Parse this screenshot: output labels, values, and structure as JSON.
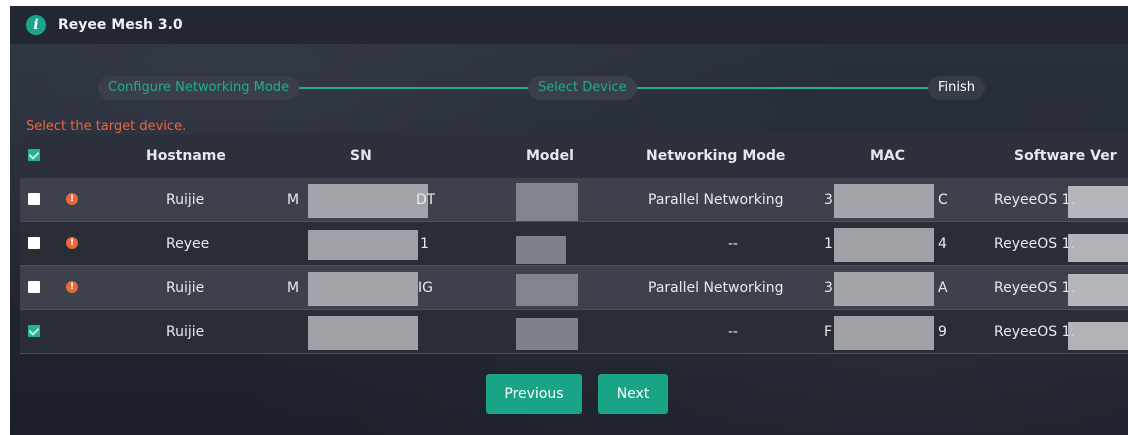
{
  "app": {
    "title": "Reyee Mesh 3.0",
    "icon": "info-icon"
  },
  "steps": [
    {
      "label": "Configure Networking Mode",
      "state": "done"
    },
    {
      "label": "Select Device",
      "state": "done"
    },
    {
      "label": "Finish",
      "state": "current"
    }
  ],
  "prompt": "Select the target device.",
  "table": {
    "columns": [
      "Hostname",
      "SN",
      "Model",
      "Networking Mode",
      "MAC",
      "Software Ver"
    ],
    "rows": [
      {
        "checked": false,
        "warning": true,
        "hostname": "Ruijie",
        "sn_prefix": "M",
        "sn_suffix": "DT",
        "networking_mode": "Parallel Networking",
        "mac_prefix": "3",
        "mac_suffix": "C",
        "software": "ReyeeOS 1."
      },
      {
        "checked": false,
        "warning": true,
        "hostname": "Reyee",
        "sn_prefix": "",
        "sn_suffix": "1",
        "networking_mode": "--",
        "mac_prefix": "1",
        "mac_suffix": "4",
        "software": "ReyeeOS 1."
      },
      {
        "checked": false,
        "warning": true,
        "hostname": "Ruijie",
        "sn_prefix": "M",
        "sn_suffix": "IG",
        "networking_mode": "Parallel Networking",
        "mac_prefix": "3",
        "mac_suffix": "A",
        "software": "ReyeeOS 1."
      },
      {
        "checked": true,
        "warning": false,
        "hostname": "Ruijie",
        "sn_prefix": "",
        "sn_suffix": "",
        "networking_mode": "--",
        "mac_prefix": "F",
        "mac_suffix": "9",
        "software": "ReyeeOS 1."
      }
    ]
  },
  "buttons": {
    "previous": "Previous",
    "next": "Next"
  },
  "colors": {
    "accent": "#1aa487",
    "warning": "#e8683a",
    "prompt": "#f0643c"
  }
}
